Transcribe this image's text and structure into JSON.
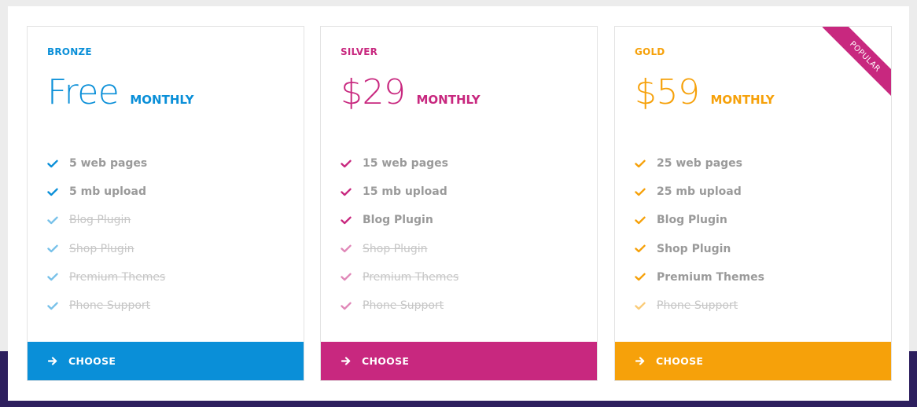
{
  "colors": {
    "bronze": "#0a8fd8",
    "silver": "#c8287f",
    "gold": "#f6a10a",
    "ribbon": "#c8287f"
  },
  "plans": [
    {
      "tier": "BRONZE",
      "price": "Free",
      "period": "MONTHLY",
      "button": "CHOOSE",
      "features": [
        {
          "label": "5 web pages",
          "included": true
        },
        {
          "label": "5 mb upload",
          "included": true
        },
        {
          "label": "Blog Plugin",
          "included": false
        },
        {
          "label": "Shop Plugin",
          "included": false
        },
        {
          "label": "Premium Themes",
          "included": false
        },
        {
          "label": "Phone Support",
          "included": false
        }
      ]
    },
    {
      "tier": "SILVER",
      "price": "$29",
      "period": "MONTHLY",
      "button": "CHOOSE",
      "features": [
        {
          "label": "15 web pages",
          "included": true
        },
        {
          "label": "15 mb upload",
          "included": true
        },
        {
          "label": "Blog Plugin",
          "included": true
        },
        {
          "label": "Shop Plugin",
          "included": false
        },
        {
          "label": "Premium Themes",
          "included": false
        },
        {
          "label": "Phone Support",
          "included": false
        }
      ]
    },
    {
      "tier": "GOLD",
      "price": "$59",
      "period": "MONTHLY",
      "button": "CHOOSE",
      "ribbon": "POPULAR",
      "features": [
        {
          "label": "25 web pages",
          "included": true
        },
        {
          "label": "25 mb upload",
          "included": true
        },
        {
          "label": "Blog Plugin",
          "included": true
        },
        {
          "label": "Shop Plugin",
          "included": true
        },
        {
          "label": "Premium Themes",
          "included": true
        },
        {
          "label": "Phone Support",
          "included": false
        }
      ]
    }
  ]
}
